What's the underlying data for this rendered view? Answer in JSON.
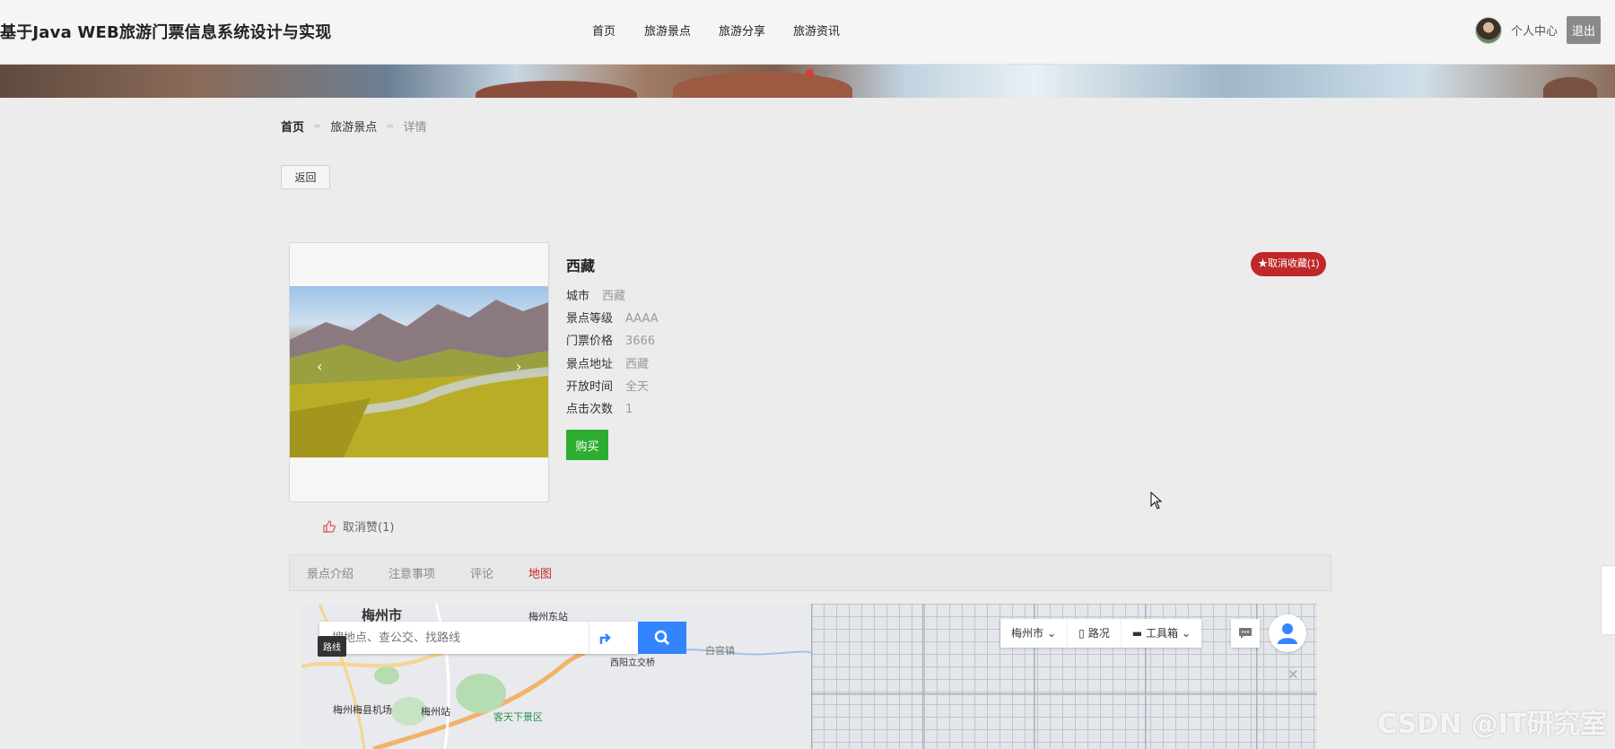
{
  "header": {
    "site_title": "基于Java WEB旅游门票信息系统设计与实现",
    "nav": [
      "首页",
      "旅游景点",
      "旅游分享",
      "旅游资讯"
    ],
    "user_center": "个人中心",
    "logout": "退出"
  },
  "breadcrumb": {
    "home": "首页",
    "section": "旅游景点",
    "current": "详情",
    "separator": "="
  },
  "back_button": "返回",
  "spot": {
    "name": "西藏",
    "unfavorite": "★取消收藏(1)",
    "fields": [
      {
        "label": "城市",
        "value": "西藏"
      },
      {
        "label": "景点等级",
        "value": "AAAA"
      },
      {
        "label": "门票价格",
        "value": "3666"
      },
      {
        "label": "景点地址",
        "value": "西藏"
      },
      {
        "label": "开放时间",
        "value": "全天"
      },
      {
        "label": "点击次数",
        "value": "1"
      }
    ],
    "buy_button": "购买",
    "unlike": "取消赞(1)",
    "carousel_prev": "‹",
    "carousel_next": "›"
  },
  "tabs": [
    {
      "label": "景点介绍",
      "active": false
    },
    {
      "label": "注意事项",
      "active": false
    },
    {
      "label": "评论",
      "active": false
    },
    {
      "label": "地图",
      "active": true
    }
  ],
  "map": {
    "city_title": "梅州市",
    "search_placeholder": "搜地点、查公交、找路线",
    "route_tooltip": "路线",
    "labels": [
      "梅州东站",
      "西阳立交桥",
      "白宫镇",
      "梅州梅县机场",
      "梅州站",
      "客天下景区"
    ],
    "tool_city": "梅州市",
    "tool_traffic": "路况",
    "tool_toolbox": "工具箱",
    "close": "✕"
  },
  "watermark": "CSDN @IT研究室",
  "colors": {
    "accent_red": "#c0282a",
    "buy_green": "#2dae31",
    "map_blue": "#3385ff"
  }
}
